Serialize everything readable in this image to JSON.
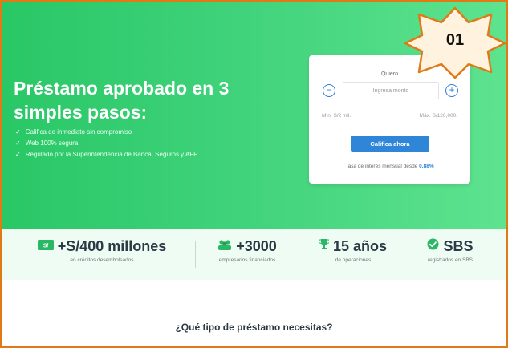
{
  "hero": {
    "title": "Préstamo aprobado en 3 simples pasos:",
    "benefits": [
      "Califica de inmediato sin compromiso",
      "Web 100% segura",
      "Regulado por la Superintendencia de Banca, Seguros y AFP"
    ]
  },
  "loan_form": {
    "label": "Quiero",
    "amount_placeholder": "Ingresa monto",
    "minus_symbol": "−",
    "plus_symbol": "+",
    "min_text": "Mín. S/2 mil.",
    "max_text": "Máx. S/120,000.",
    "submit_label": "Califica ahora",
    "rate_text": "Tasa de interés mensual desde",
    "rate_value": "0.88%"
  },
  "badge": {
    "number": "01"
  },
  "stats": [
    {
      "icon": "money-icon",
      "value": "+S/400 millones",
      "label": "en créditos desembolsados"
    },
    {
      "icon": "people-icon",
      "value": "+3000",
      "label": "empresarios financiados"
    },
    {
      "icon": "trophy-icon",
      "value": "15 años",
      "label": "de operaciones"
    },
    {
      "icon": "check-badge-icon",
      "value": "SBS",
      "label": "registrados en SBS"
    }
  ],
  "section": {
    "heading": "¿Qué tipo de préstamo necesitas?"
  },
  "colors": {
    "hero_start": "#29c766",
    "hero_end": "#5ee38f",
    "primary_button": "#2f86d9",
    "badge_fill": "#fff3df",
    "badge_stroke": "#e07a16",
    "frame_border": "#e07a16",
    "stats_background": "#eefcf4"
  }
}
